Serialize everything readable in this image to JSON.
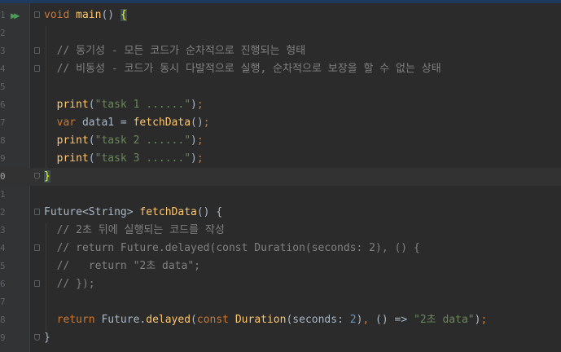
{
  "editor": {
    "gutter_line_labels": [
      "1",
      "2",
      "3",
      "4",
      "5",
      "6",
      "7",
      "8",
      "9",
      "0",
      "1",
      "2",
      "3",
      "4",
      "5",
      "6",
      "7",
      "8",
      "9"
    ],
    "lines": [
      [
        {
          "t": "void",
          "c": "k"
        },
        {
          "t": " "
        },
        {
          "t": "main",
          "c": "f"
        },
        {
          "t": "() "
        },
        {
          "t": "{",
          "c": "b"
        }
      ],
      [],
      [
        {
          "t": "  // 동기성 - 모든 코드가 순차적으로 진행되는 형태",
          "c": "c"
        }
      ],
      [
        {
          "t": "  // 비동성 - 코드가 동시 다발적으로 실행, 순차적으로 보장을 할 수 없는 상태",
          "c": "c"
        }
      ],
      [],
      [
        {
          "t": "  "
        },
        {
          "t": "print",
          "c": "f"
        },
        {
          "t": "("
        },
        {
          "t": "\"task 1 ......\"",
          "c": "s"
        },
        {
          "t": ")"
        },
        {
          "t": ";",
          "c": "k"
        }
      ],
      [
        {
          "t": "  "
        },
        {
          "t": "var",
          "c": "k"
        },
        {
          "t": " data1 = "
        },
        {
          "t": "fetchData",
          "c": "f"
        },
        {
          "t": "()"
        },
        {
          "t": ";",
          "c": "k"
        }
      ],
      [
        {
          "t": "  "
        },
        {
          "t": "print",
          "c": "f"
        },
        {
          "t": "("
        },
        {
          "t": "\"task 2 ......\"",
          "c": "s"
        },
        {
          "t": ")"
        },
        {
          "t": ";",
          "c": "k"
        }
      ],
      [
        {
          "t": "  "
        },
        {
          "t": "print",
          "c": "f"
        },
        {
          "t": "("
        },
        {
          "t": "\"task 3 ......\"",
          "c": "s"
        },
        {
          "t": ")"
        },
        {
          "t": ";",
          "c": "k"
        }
      ],
      [
        {
          "t": "}",
          "c": "b"
        }
      ],
      [],
      [
        {
          "t": "Future<String> "
        },
        {
          "t": "fetchData",
          "c": "f"
        },
        {
          "t": "() {"
        }
      ],
      [
        {
          "t": "  // 2초 뒤에 실행되는 코드를 작성",
          "c": "c"
        }
      ],
      [
        {
          "t": "  // return Future.delayed(const Duration(seconds: 2), () {",
          "c": "c"
        }
      ],
      [
        {
          "t": "  //   return \"2초 data\";",
          "c": "c"
        }
      ],
      [
        {
          "t": "  // });",
          "c": "c"
        }
      ],
      [],
      [
        {
          "t": "  "
        },
        {
          "t": "return",
          "c": "k"
        },
        {
          "t": " "
        },
        {
          "t": "Future",
          "c": "p"
        },
        {
          "t": "."
        },
        {
          "t": "delayed",
          "c": "f"
        },
        {
          "t": "("
        },
        {
          "t": "const",
          "c": "k"
        },
        {
          "t": " "
        },
        {
          "t": "Duration",
          "c": "f"
        },
        {
          "t": "(seconds: "
        },
        {
          "t": "2",
          "c": "n"
        },
        {
          "t": ")"
        },
        {
          "t": ",",
          "c": "k"
        },
        {
          "t": " () => "
        },
        {
          "t": "\"2초 data\"",
          "c": "s"
        },
        {
          "t": ")"
        },
        {
          "t": ";",
          "c": "k"
        }
      ],
      [
        {
          "t": "}"
        }
      ]
    ],
    "current_line_index": 9,
    "run_icon": "run-main-icon"
  }
}
